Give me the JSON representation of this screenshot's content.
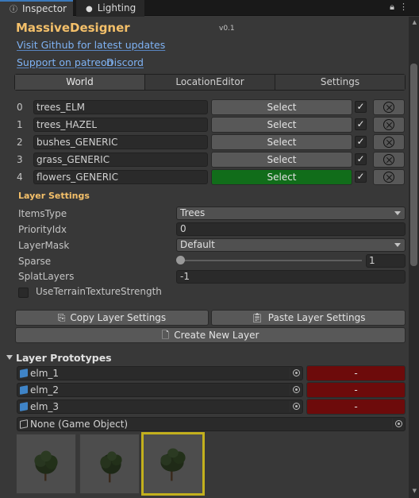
{
  "tabs": {
    "inspector": "Inspector",
    "lighting": "Lighting"
  },
  "header": {
    "title": "MassiveDesigner",
    "version": "v0.1",
    "github_link": "Visit Github for latest updates",
    "patreon_link": "Support on patreon",
    "discord_link": "Discord"
  },
  "toolbar": {
    "tabs": [
      "World",
      "LocationEditor",
      "Settings"
    ],
    "selected": "World"
  },
  "layers": [
    {
      "index": "0",
      "name": "trees_ELM",
      "select_label": "Select",
      "enabled": true,
      "active": false
    },
    {
      "index": "1",
      "name": "trees_HAZEL",
      "select_label": "Select",
      "enabled": true,
      "active": false
    },
    {
      "index": "2",
      "name": "bushes_GENERIC",
      "select_label": "Select",
      "enabled": true,
      "active": false
    },
    {
      "index": "3",
      "name": "grass_GENERIC",
      "select_label": "Select",
      "enabled": true,
      "active": false
    },
    {
      "index": "4",
      "name": "flowers_GENERIC",
      "select_label": "Select",
      "enabled": true,
      "active": true
    }
  ],
  "layer_settings": {
    "heading": "Layer Settings",
    "items_type_label": "ItemsType",
    "items_type_value": "Trees",
    "priority_label": "PriorityIdx",
    "priority_value": "0",
    "layermask_label": "LayerMask",
    "layermask_value": "Default",
    "sparse_label": "Sparse",
    "sparse_value": "1",
    "splat_label": "SplatLayers",
    "splat_value": "-1",
    "use_terrain_label": "UseTerrainTextureStrength",
    "use_terrain_checked": false
  },
  "buttons": {
    "copy": "Copy Layer Settings",
    "paste": "Paste Layer Settings",
    "create": "Create New Layer"
  },
  "prototypes": {
    "heading": "Layer Prototypes",
    "items": [
      {
        "name": "elm_1",
        "remove_label": "-"
      },
      {
        "name": "elm_2",
        "remove_label": "-"
      },
      {
        "name": "elm_3",
        "remove_label": "-"
      }
    ],
    "add_field": "None (Game Object)",
    "thumbnails": [
      "tree-preview-1",
      "tree-preview-2",
      "tree-preview-3"
    ],
    "selected_thumbnail": 2
  },
  "colors": {
    "accent_title": "#f4c06a",
    "link": "#7fb3f5",
    "active_select": "#116d1a",
    "remove_button": "#6d0b0b",
    "thumbnail_selection": "#c3b01d"
  }
}
